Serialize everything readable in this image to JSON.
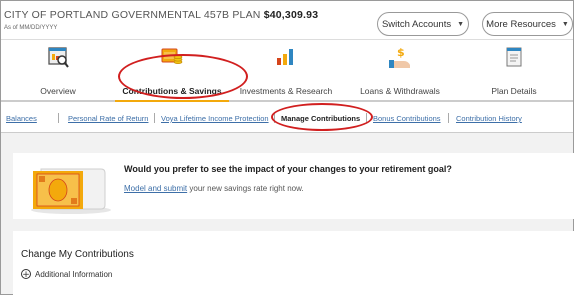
{
  "header": {
    "plan_name": "CITY OF PORTLAND GOVERNMENTAL 457B PLAN",
    "plan_balance": "$40,309.93",
    "as_of": "As of MM/DD/YYYY",
    "switch_accounts": "Switch Accounts",
    "more_resources": "More Resources"
  },
  "tabs": [
    {
      "label": "Overview",
      "icon": "magnifier-chart-icon"
    },
    {
      "label": "Contributions & Savings",
      "icon": "coins-icon",
      "active": true
    },
    {
      "label": "Investments & Research",
      "icon": "bar-chart-icon"
    },
    {
      "label": "Loans & Withdrawals",
      "icon": "hand-dollar-icon"
    },
    {
      "label": "Plan Details",
      "icon": "document-icon"
    }
  ],
  "subnav": [
    {
      "label": "Balances"
    },
    {
      "label": "Personal Rate of Return"
    },
    {
      "label": "Voya Lifetime Income Protection"
    },
    {
      "label": "Manage Contributions",
      "active": true
    },
    {
      "label": "Bonus Contributions"
    },
    {
      "label": "Contribution History"
    }
  ],
  "promo": {
    "question": "Would you prefer to see the impact of your changes to your retirement goal?",
    "link_text": "Model and submit",
    "rest_text": " your new savings rate right now."
  },
  "contributions": {
    "title": "Change My Contributions",
    "additional_info": "Additional Information"
  },
  "colors": {
    "accent": "#f3a90c",
    "annotation": "#d11f1f",
    "link": "#3d6fa8"
  }
}
